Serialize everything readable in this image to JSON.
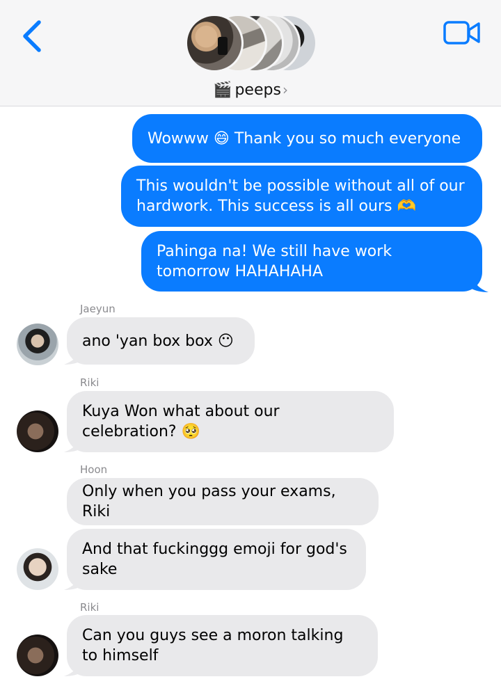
{
  "header": {
    "group_name": "peeps",
    "group_emoji": "🎬",
    "chevron": "›",
    "back_icon": "chevron-left-icon",
    "video_icon": "video-camera-icon",
    "accent": "#0a7cff"
  },
  "messages": [
    {
      "direction": "sent",
      "text": "Wowww 😄 Thank you so much everyone"
    },
    {
      "direction": "sent",
      "text": "This wouldn't be possible without all of our hardwork. This success is all ours 🫶"
    },
    {
      "direction": "sent",
      "text": "Pahinga na! We still have work tomorrow HAHAHAHA"
    },
    {
      "direction": "received",
      "sender": "Jaeyun",
      "text": "ano 'yan box box 😶"
    },
    {
      "direction": "received",
      "sender": "Riki",
      "text": "Kuya Won what about our celebration? 🥺"
    },
    {
      "direction": "received",
      "sender": "Hoon",
      "text": "Only when you pass your exams, Riki"
    },
    {
      "direction": "received",
      "text": "And that fuckinggg emoji for god's sake"
    },
    {
      "direction": "received",
      "sender": "Riki",
      "text": "Can you guys see a moron talking to himself"
    }
  ],
  "colors": {
    "sent_bubble": "#0a7cff",
    "received_bubble": "#e9e9eb"
  }
}
